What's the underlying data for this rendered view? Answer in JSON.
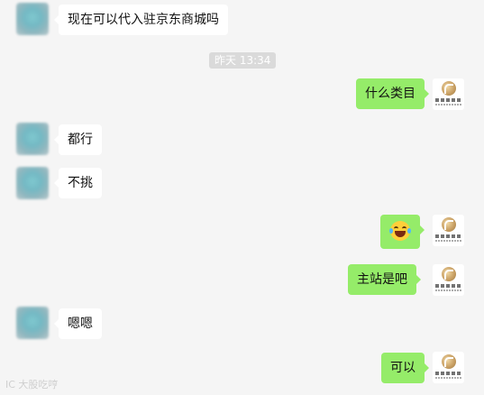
{
  "time_label": "昨天 13:34",
  "watermark": "IC 大股吃哼",
  "messages": [
    {
      "side": "in",
      "text": "现在可以代入驻京东商城吗"
    },
    {
      "side": "out",
      "text": "什么类目"
    },
    {
      "side": "in",
      "text": "都行"
    },
    {
      "side": "in",
      "text": "不挑"
    },
    {
      "side": "out",
      "emoji": "face-with-tears-of-joy"
    },
    {
      "side": "out",
      "text": "主站是吧"
    },
    {
      "side": "in",
      "text": "嗯嗯"
    },
    {
      "side": "out",
      "text": "可以"
    }
  ],
  "colors": {
    "background": "#f5f5f5",
    "incoming_bubble": "#ffffff",
    "outgoing_bubble": "#95ec69",
    "time_pill": "#dadada"
  }
}
